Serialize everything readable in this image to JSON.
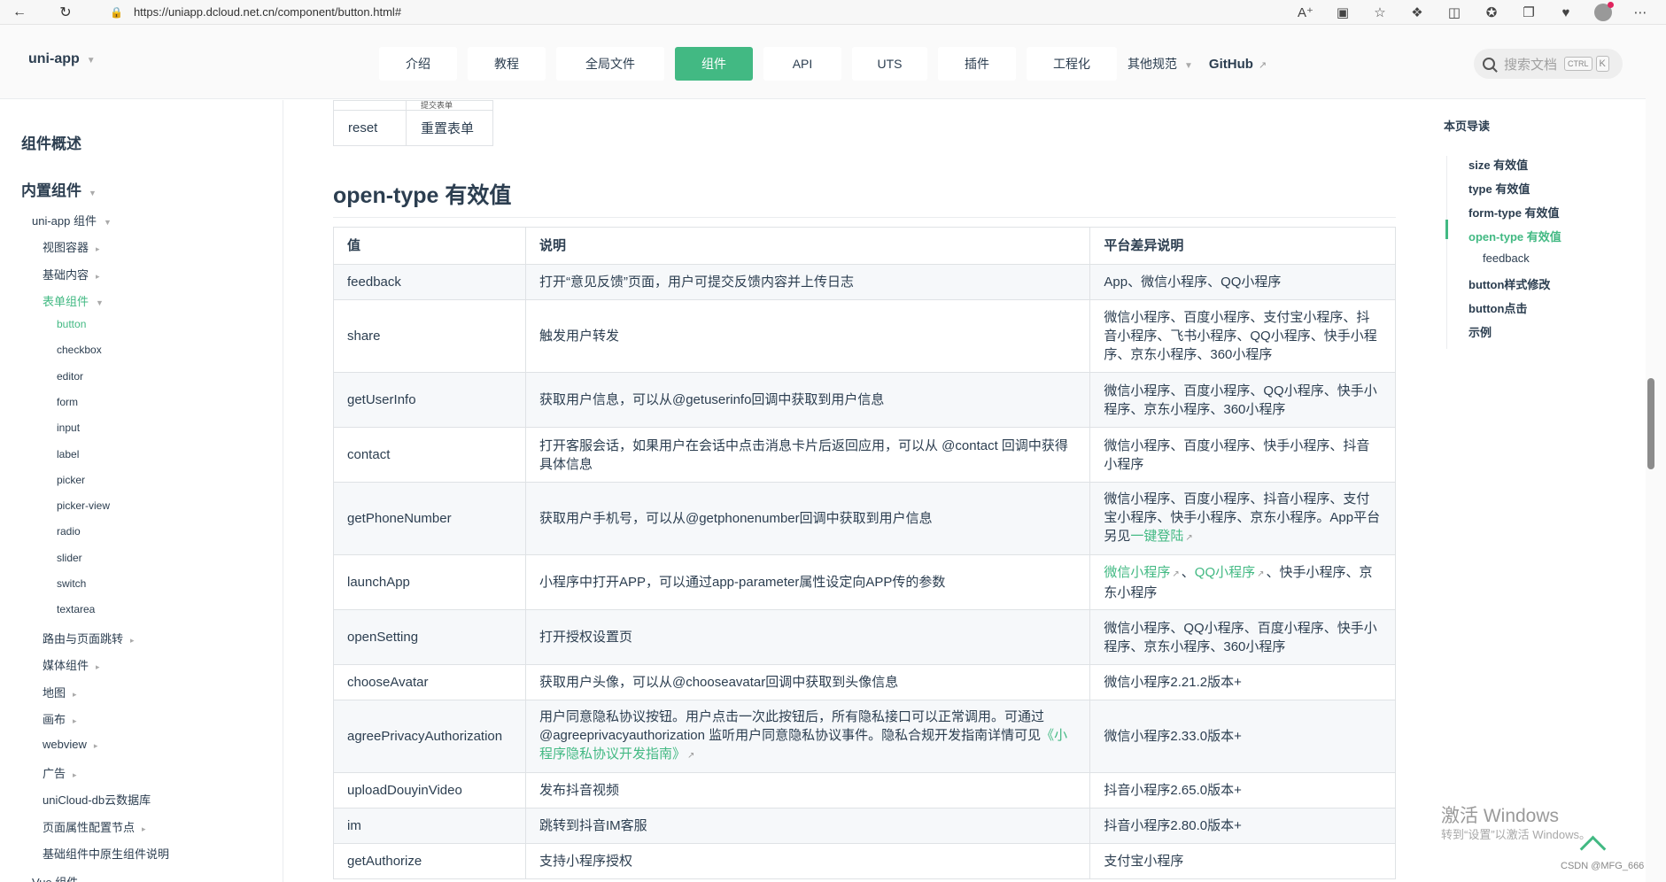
{
  "browser": {
    "url": "https://uniapp.dcloud.net.cn/component/button.html#"
  },
  "header": {
    "logo": "uni-app",
    "tabs": [
      {
        "label": "介绍",
        "w": 88
      },
      {
        "label": "教程",
        "w": 88
      },
      {
        "label": "全局文件",
        "w": 122
      },
      {
        "label": "组件",
        "w": 88,
        "active": true
      },
      {
        "label": "API",
        "w": 88
      },
      {
        "label": "UTS",
        "w": 85
      },
      {
        "label": "插件",
        "w": 88
      },
      {
        "label": "工程化",
        "w": 102
      }
    ],
    "more_label": "其他规范",
    "github_label": "GitHub",
    "search_placeholder": "搜索文档",
    "search_key1": "CTRL",
    "search_key2": "K"
  },
  "sidebar": {
    "overview": "组件概述",
    "builtin": "内置组件",
    "uniapp_components": "uni-app 组件",
    "view_container": "视图容器",
    "basic_content": "基础内容",
    "form_components": "表单组件",
    "form_items": [
      "button",
      "checkbox",
      "editor",
      "form",
      "input",
      "label",
      "picker",
      "picker-view",
      "radio",
      "slider",
      "switch",
      "textarea"
    ],
    "after_items": [
      "路由与页面跳转",
      "媒体组件",
      "地图",
      "画布",
      "webview",
      "广告",
      "uniCloud-db云数据库",
      "页面属性配置节点",
      "基础组件中原生组件说明"
    ],
    "vue_components": "Vue 组件"
  },
  "prev_table": {
    "cut_value": "提交表单",
    "row_key": "reset",
    "row_desc": "重置表单"
  },
  "section_title": "open-type 有效值",
  "table": {
    "headers": [
      "值",
      "说明",
      "平台差异说明"
    ],
    "rows": [
      {
        "value": "feedback",
        "desc": "打开“意见反馈”页面，用户可提交反馈内容并上传日志",
        "platform": "App、微信小程序、QQ小程序"
      },
      {
        "value": "share",
        "desc": "触发用户转发",
        "platform": "微信小程序、百度小程序、支付宝小程序、抖音小程序、飞书小程序、QQ小程序、快手小程序、京东小程序、360小程序"
      },
      {
        "value": "getUserInfo",
        "desc": "获取用户信息，可以从@getuserinfo回调中获取到用户信息",
        "platform": "微信小程序、百度小程序、QQ小程序、快手小程序、京东小程序、360小程序"
      },
      {
        "value": "contact",
        "desc": "打开客服会话，如果用户在会话中点击消息卡片后返回应用，可以从 @contact 回调中获得具体信息",
        "platform": "微信小程序、百度小程序、快手小程序、抖音小程序"
      },
      {
        "value": "getPhoneNumber",
        "desc": "获取用户手机号，可以从@getphonenumber回调中获取到用户信息",
        "platform": "微信小程序、百度小程序、抖音小程序、支付宝小程序、快手小程序、京东小程序。App平台另见",
        "platform_link": "一键登陆"
      },
      {
        "value": "launchApp",
        "desc": "小程序中打开APP，可以通过app-parameter属性设定向APP传的参数",
        "platform_link1": "微信小程序",
        "platform_sep": "、",
        "platform_link2": "QQ小程序",
        "platform_tail": "、快手小程序、京东小程序"
      },
      {
        "value": "openSetting",
        "desc": "打开授权设置页",
        "platform": "微信小程序、QQ小程序、百度小程序、快手小程序、京东小程序、360小程序"
      },
      {
        "value": "chooseAvatar",
        "desc": "获取用户头像，可以从@chooseavatar回调中获取到头像信息",
        "platform": "微信小程序2.21.2版本+"
      },
      {
        "value": "agreePrivacyAuthorization",
        "desc": "用户同意隐私协议按钮。用户点击一次此按钮后，所有隐私接口可以正常调用。可通过 @agreeprivacyauthorization 监听用户同意隐私协议事件。隐私合规开发指南详情可见",
        "desc_link": "《小程序隐私协议开发指南》",
        "platform": "微信小程序2.33.0版本+"
      },
      {
        "value": "uploadDouyinVideo",
        "desc": "发布抖音视频",
        "platform": "抖音小程序2.65.0版本+"
      },
      {
        "value": "im",
        "desc": "跳转到抖音IM客服",
        "platform": "抖音小程序2.80.0版本+"
      },
      {
        "value": "getAuthorize",
        "desc": "支持小程序授权",
        "platform": "支付宝小程序"
      }
    ]
  },
  "toc": {
    "title": "本页导读",
    "items": [
      "size 有效值",
      "type 有效值",
      "form-type 有效值",
      "open-type 有效值",
      "feedback",
      "button样式修改",
      "button点击",
      "示例"
    ]
  },
  "watermark": {
    "line1": "激活 Windows",
    "line2": "转到“设置”以激活 Windows。",
    "csdn": "CSDN @MFG_666"
  }
}
